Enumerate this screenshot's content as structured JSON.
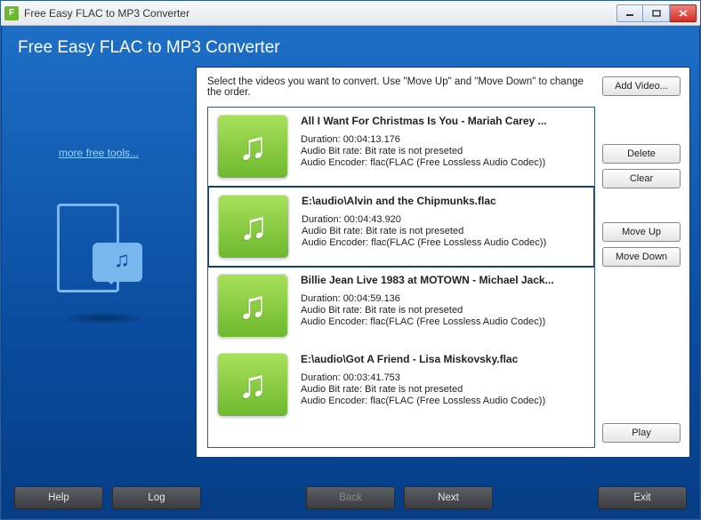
{
  "window": {
    "title": "Free Easy FLAC to MP3 Converter",
    "app_title": "Free Easy FLAC to MP3 Converter"
  },
  "sidebar": {
    "more_link": "more free tools..."
  },
  "content": {
    "instruction": "Select the videos you want to convert. Use \"Move Up\" and \"Move Down\" to change the order.",
    "files": [
      {
        "title": "All I Want For Christmas Is You - Mariah Carey ...",
        "duration": "Duration: 00:04:13.176",
        "bitrate": "Audio Bit rate: Bit rate is not preseted",
        "encoder": "Audio Encoder: flac(FLAC (Free Lossless Audio Codec))",
        "selected": false
      },
      {
        "title": "E:\\audio\\Alvin and the Chipmunks.flac",
        "duration": "Duration: 00:04:43.920",
        "bitrate": "Audio Bit rate: Bit rate is not preseted",
        "encoder": "Audio Encoder: flac(FLAC (Free Lossless Audio Codec))",
        "selected": true
      },
      {
        "title": "Billie Jean Live 1983 at MOTOWN - Michael Jack...",
        "duration": "Duration: 00:04:59.136",
        "bitrate": "Audio Bit rate: Bit rate is not preseted",
        "encoder": "Audio Encoder: flac(FLAC (Free Lossless Audio Codec))",
        "selected": false
      },
      {
        "title": "E:\\audio\\Got A Friend - Lisa Miskovsky.flac",
        "duration": "Duration: 00:03:41.753",
        "bitrate": "Audio Bit rate: Bit rate is not preseted",
        "encoder": "Audio Encoder: flac(FLAC (Free Lossless Audio Codec))",
        "selected": false
      }
    ]
  },
  "actions": {
    "add_video": "Add Video...",
    "delete": "Delete",
    "clear": "Clear",
    "move_up": "Move Up",
    "move_down": "Move Down",
    "play": "Play"
  },
  "bottom": {
    "help": "Help",
    "log": "Log",
    "back": "Back",
    "next": "Next",
    "exit": "Exit"
  }
}
